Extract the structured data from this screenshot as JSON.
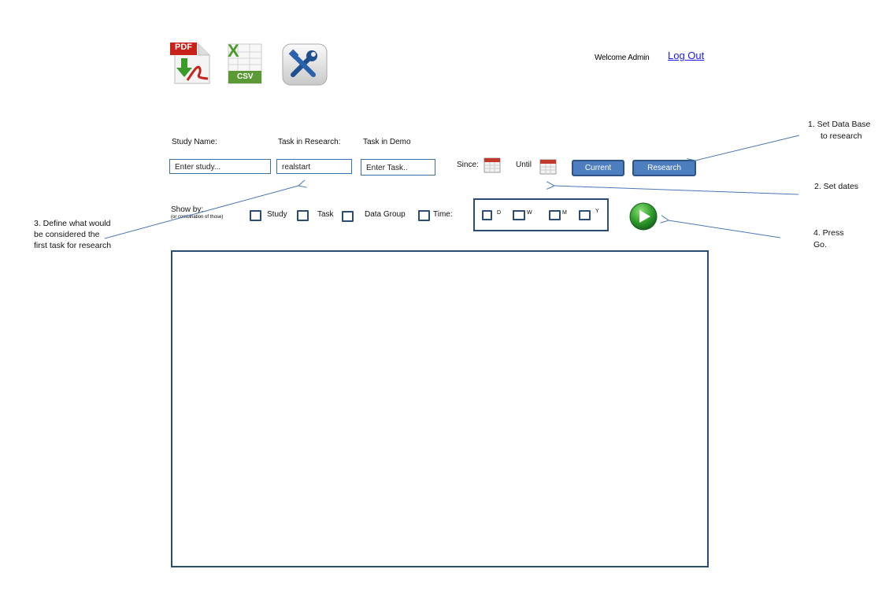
{
  "toolbar": {
    "pdf_label": "PDF",
    "csv_label": "CSV",
    "excel_letter": "X"
  },
  "header": {
    "welcome": "Welcome Admin",
    "logout": "Log Out"
  },
  "fields": {
    "study_name_label": "Study Name:",
    "study_placeholder": "Enter study...",
    "task_research_label": "Task in Research:",
    "task_research_value": "realstart",
    "task_demo_label": "Task in Demo",
    "task_demo_placeholder": "Enter Task..",
    "since_label": "Since:",
    "until_label": "Until"
  },
  "buttons": {
    "current": "Current",
    "research": "Research"
  },
  "show_by": {
    "label": "Show by:",
    "sublabel": "(or combination of those)",
    "options": [
      "Study",
      "Task",
      "Data Group",
      "Time:"
    ],
    "time_options": [
      "D",
      "W",
      "M",
      "Y"
    ]
  },
  "notes": {
    "note1_line1": "1.  Set Data Base",
    "note1_line2": "to research",
    "note2": "2. Set dates",
    "note3_line1": "3. Define what would",
    "note3_line2": "be considered the",
    "note3_line3": "first task for research",
    "note4_line1": "4. Press",
    "note4_line2": "Go."
  }
}
